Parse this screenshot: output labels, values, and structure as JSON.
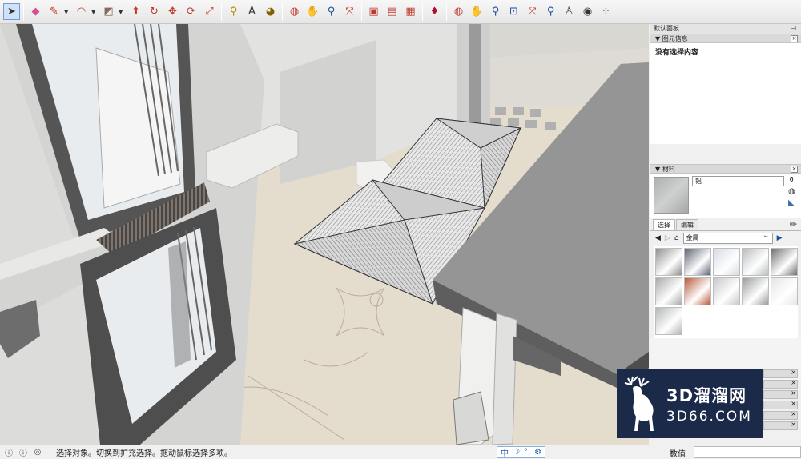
{
  "tray": {
    "title": "默认面板",
    "entity_info": {
      "title": "图元信息",
      "content": "没有选择内容"
    },
    "materials": {
      "title": "材料",
      "current_name": "铝",
      "tabs": [
        "选择",
        "编辑"
      ],
      "library": "金属",
      "swatches": [
        {
          "name": "metal-pattern",
          "color": "#8f8f8f"
        },
        {
          "name": "metal-blue-dark",
          "color": "#5c6472"
        },
        {
          "name": "metal-light-blue",
          "color": "#d5dbe2"
        },
        {
          "name": "metal-silver",
          "color": "#b9bdbf"
        },
        {
          "name": "metal-dark-grey",
          "color": "#707070"
        },
        {
          "name": "metal-brushed",
          "color": "#a9a9a9"
        },
        {
          "name": "metal-copper",
          "color": "#b85a3c"
        },
        {
          "name": "metal-diamond-plate",
          "color": "#c8c8c8"
        },
        {
          "name": "metal-grey",
          "color": "#9a9c9e"
        },
        {
          "name": "metal-white",
          "color": "#e4e6e8"
        },
        {
          "name": "metal-aluminum",
          "color": "#b4b6b6"
        }
      ]
    }
  },
  "watermark": {
    "title": "3D溜溜网",
    "subtitle": "3D66.COM"
  },
  "status": {
    "message": "选择对象。切换到扩充选择。拖动鼠标选择多项。",
    "ime_lang": "中",
    "value_label": "数值"
  }
}
